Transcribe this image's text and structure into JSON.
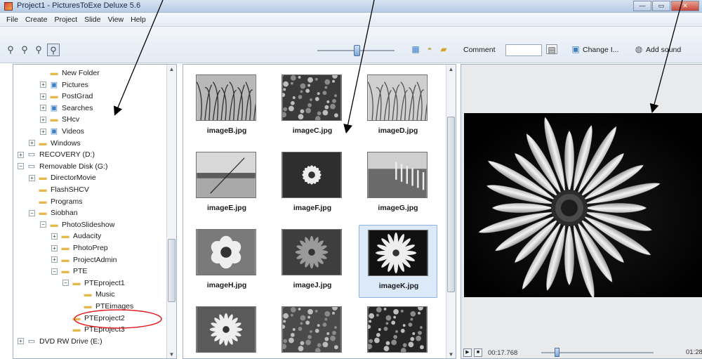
{
  "window": {
    "title": "Project1 - PicturesToExe Deluxe 5.6",
    "min": "—",
    "max": "▭",
    "close": "✕"
  },
  "menu": [
    "File",
    "Create",
    "Project",
    "Slide",
    "View",
    "Help"
  ],
  "toolbar": {
    "comment_label": "Comment",
    "comment_value": "",
    "change_label": "Change I...",
    "add_sound_label": "Add sound",
    "icons": [
      "view-icon-1",
      "view-icon-2",
      "view-icon-3",
      "view-icon-4"
    ]
  },
  "tree": [
    {
      "label": "New Folder",
      "indent": 4,
      "icon": "folder"
    },
    {
      "label": "Pictures",
      "indent": 4,
      "icon": "special",
      "exp": "+"
    },
    {
      "label": "PostGrad",
      "indent": 4,
      "icon": "folder",
      "exp": "+"
    },
    {
      "label": "Searches",
      "indent": 4,
      "icon": "special",
      "exp": "+"
    },
    {
      "label": "SHcv",
      "indent": 4,
      "icon": "folder",
      "exp": "+"
    },
    {
      "label": "Videos",
      "indent": 4,
      "icon": "special",
      "exp": "+"
    },
    {
      "label": "Windows",
      "indent": 2,
      "icon": "folder",
      "exp": "+"
    },
    {
      "label": "RECOVERY (D:)",
      "indent": 0,
      "icon": "drive",
      "exp": "+"
    },
    {
      "label": "Removable Disk (G:)",
      "indent": 0,
      "icon": "drive",
      "exp": "−"
    },
    {
      "label": "DirectorMovie",
      "indent": 2,
      "icon": "folder",
      "exp": "+"
    },
    {
      "label": "FlashSHCV",
      "indent": 2,
      "icon": "folder"
    },
    {
      "label": "Programs",
      "indent": 2,
      "icon": "folder"
    },
    {
      "label": "Siobhan",
      "indent": 2,
      "icon": "folder",
      "exp": "−"
    },
    {
      "label": "PhotoSlideshow",
      "indent": 4,
      "icon": "folder",
      "exp": "−"
    },
    {
      "label": "Audacity",
      "indent": 6,
      "icon": "folder",
      "exp": "+"
    },
    {
      "label": "PhotoPrep",
      "indent": 6,
      "icon": "folder",
      "exp": "+"
    },
    {
      "label": "ProjectAdmin",
      "indent": 6,
      "icon": "folder",
      "exp": "+"
    },
    {
      "label": "PTE",
      "indent": 6,
      "icon": "folder",
      "exp": "−"
    },
    {
      "label": "PTEproject1",
      "indent": 8,
      "icon": "folder",
      "exp": "−"
    },
    {
      "label": "Music",
      "indent": 10,
      "icon": "folder"
    },
    {
      "label": "PTEimages",
      "indent": 10,
      "icon": "folder",
      "selected": true
    },
    {
      "label": "PTEproject2",
      "indent": 8,
      "icon": "folder"
    },
    {
      "label": "PTEproject3",
      "indent": 8,
      "icon": "folder"
    },
    {
      "label": "DVD RW Drive (E:)",
      "indent": 0,
      "icon": "drive",
      "exp": "+"
    }
  ],
  "thumbnails": [
    {
      "caption": "imageB.jpg",
      "kind": "grass"
    },
    {
      "caption": "imageC.jpg",
      "kind": "foliage"
    },
    {
      "caption": "imageD.jpg",
      "kind": "tallgrass"
    },
    {
      "caption": "imageE.jpg",
      "kind": "beach"
    },
    {
      "caption": "imageF.jpg",
      "kind": "daisy"
    },
    {
      "caption": "imageG.jpg",
      "kind": "fence"
    },
    {
      "caption": "imageH.jpg",
      "kind": "tulip"
    },
    {
      "caption": "imageJ.jpg",
      "kind": "petals"
    },
    {
      "caption": "imageK.jpg",
      "kind": "bigdaisy",
      "selected": true
    },
    {
      "caption": "",
      "kind": "sunflower"
    },
    {
      "caption": "",
      "kind": "succulent"
    },
    {
      "caption": "",
      "kind": "clusters"
    }
  ],
  "player": {
    "current_time": "00:17.768",
    "total_time": "01:28",
    "play": "▶",
    "stop": "■",
    "position": 0.12
  }
}
